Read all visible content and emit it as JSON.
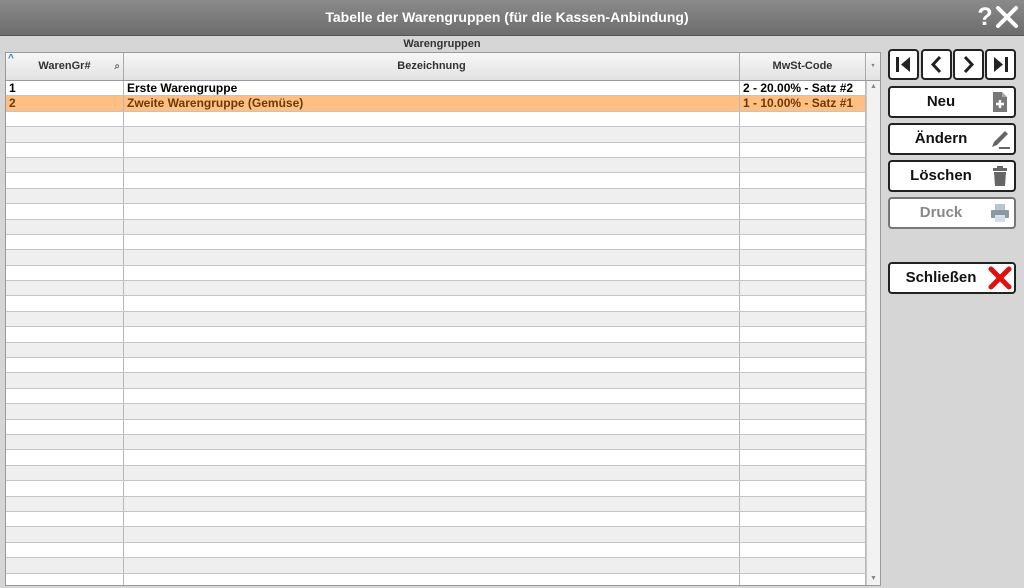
{
  "window": {
    "title": "Tabelle der Warengruppen (für die Kassen-Anbindung)",
    "help_glyph": "?"
  },
  "grid": {
    "caption": "Warengruppen",
    "columns": [
      "WarenGr#",
      "Bezeichnung",
      "MwSt-Code"
    ],
    "rows": [
      {
        "id": "1",
        "name": "Erste Warengruppe",
        "vat": "2 - 20.00% - Satz #2"
      },
      {
        "id": "2",
        "name": "Zweite Warengruppe (Gemüse)",
        "vat": "1 - 10.00% - Satz #1",
        "selected": true
      }
    ]
  },
  "buttons": {
    "new": "Neu",
    "edit": "Ändern",
    "delete": "Löschen",
    "print": "Druck",
    "close": "Schließen"
  },
  "colors": {
    "titlebar": "#777777",
    "selected_row": "#ffbf80",
    "close_x": "#e01010"
  }
}
